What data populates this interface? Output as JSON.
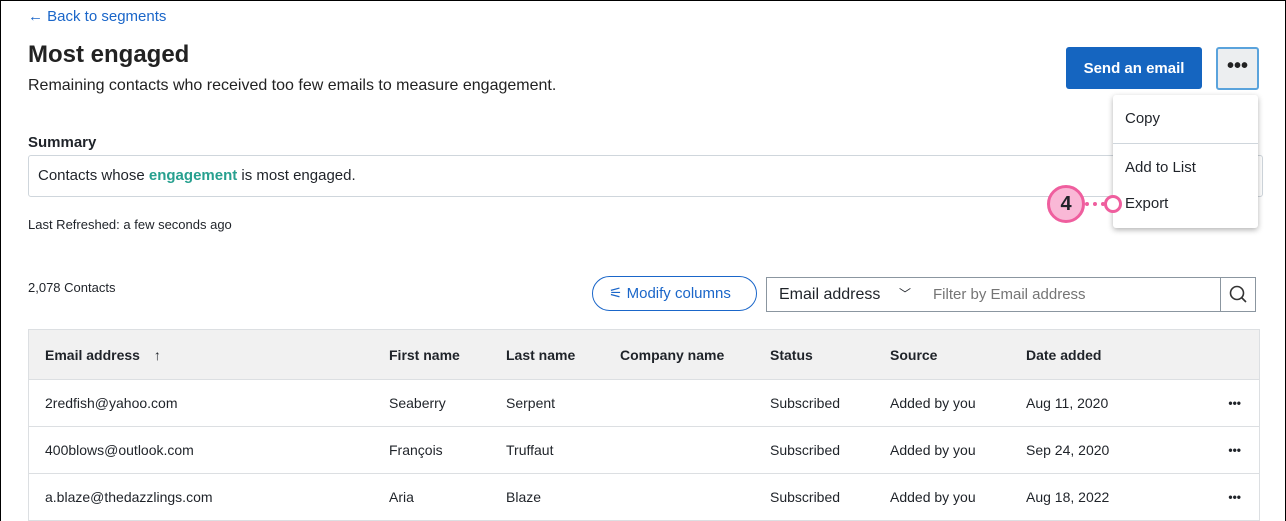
{
  "back_link": "Back to segments",
  "title": "Most engaged",
  "subtitle": "Remaining contacts who received too few emails to measure engagement.",
  "send_button": "Send an email",
  "more_button": "•••",
  "menu": {
    "items": [
      "Copy",
      "Add to List",
      "Export"
    ]
  },
  "annotation": {
    "step": "4"
  },
  "summary": {
    "label": "Summary",
    "prefix": "Contacts whose ",
    "highlight": "engagement",
    "suffix": " is most engaged."
  },
  "last_refreshed": "Last Refreshed: a few seconds ago",
  "contacts_count": "2,078 Contacts",
  "modify_columns": "Modify columns",
  "filter": {
    "select_value": "Email address",
    "placeholder": "Filter by Email address"
  },
  "table": {
    "headers": [
      "Email address",
      "First name",
      "Last name",
      "Company name",
      "Status",
      "Source",
      "Date added"
    ],
    "sort_indicator": "↑",
    "rows": [
      [
        "2redfish@yahoo.com",
        "Seaberry",
        "Serpent",
        "",
        "Subscribed",
        "Added by you",
        "Aug 11, 2020"
      ],
      [
        "400blows@outlook.com",
        "François",
        "Truffaut",
        "",
        "Subscribed",
        "Added by you",
        "Sep 24, 2020"
      ],
      [
        "a.blaze@thedazzlings.com",
        "Aria",
        "Blaze",
        "",
        "Subscribed",
        "Added by you",
        "Aug 18, 2022"
      ]
    ],
    "row_action": "•••"
  }
}
